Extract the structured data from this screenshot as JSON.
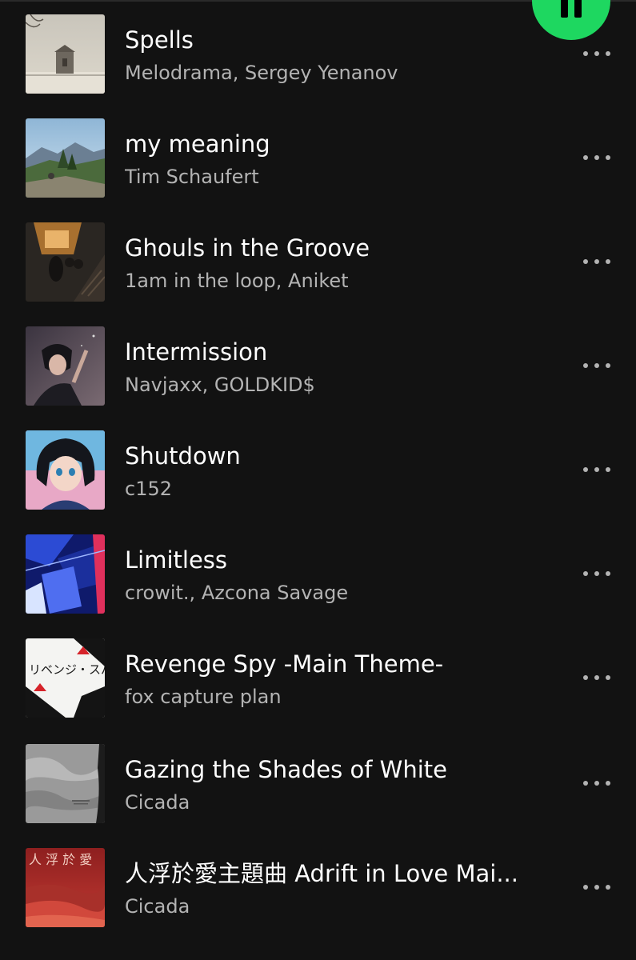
{
  "tracks": [
    {
      "title": "Spells",
      "artist": "Melodrama, Sergey Yenanov",
      "cover_icon": "cabin-in-snow"
    },
    {
      "title": "my meaning",
      "artist": "Tim Schaufert",
      "cover_icon": "mountain-landscape"
    },
    {
      "title": "Ghouls in the Groove",
      "artist": "1am in the loop, Aniket",
      "cover_icon": "ghosts-on-stairs"
    },
    {
      "title": "Intermission",
      "artist": "Navjaxx, GOLDKID$",
      "cover_icon": "anime-boy-night"
    },
    {
      "title": "Shutdown",
      "artist": "c152",
      "cover_icon": "anime-girl-portrait"
    },
    {
      "title": "Limitless",
      "artist": "crowit., Azcona Savage",
      "cover_icon": "abstract-blue-cubes"
    },
    {
      "title": "Revenge Spy -Main Theme-",
      "artist": "fox capture plan",
      "cover_icon": "revenge-spy-soundtrack",
      "cover_text": "リベンジ・スパイ"
    },
    {
      "title": "Gazing the Shades of White",
      "artist": "Cicada",
      "cover_icon": "grey-map-texture"
    },
    {
      "title": "人浮於愛主題曲 Adrift in Love Mai...",
      "artist": "Cicada",
      "cover_icon": "red-dunes",
      "cover_text": "人 浮 於 愛"
    }
  ],
  "colors": {
    "background": "#121212",
    "accent": "#1ed760",
    "title": "#ffffff",
    "subtitle": "#b3b3b3"
  },
  "play_button_icon": "pause-icon"
}
